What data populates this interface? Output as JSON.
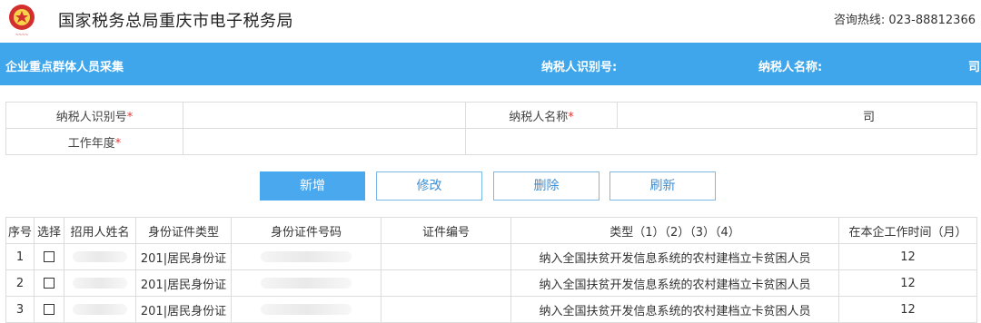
{
  "header": {
    "site_title": "国家税务总局重庆市电子税务局",
    "hotline": "咨询热线: 023-88812366",
    "emblem_icon": "tax-emblem-icon"
  },
  "bar": {
    "section_title": "企业重点群体人员采集",
    "taxpayer_id_label": "纳税人识别号:",
    "taxpayer_name_label": "纳税人名称:",
    "taxpayer_name_tail": "司"
  },
  "form": {
    "taxpayer_id_label": "纳税人识别号",
    "taxpayer_name_label": "纳税人名称",
    "taxpayer_name_tail": "司",
    "work_year_label": "工作年度",
    "required_mark": "*"
  },
  "toolbar": {
    "add_label": "新增",
    "edit_label": "修改",
    "delete_label": "删除",
    "refresh_label": "刷新"
  },
  "table": {
    "headers": [
      "序号",
      "选择",
      "招用人姓名",
      "身份证件类型",
      "身份证件号码",
      "证件编号",
      "类型（1）（2）（3）（4）",
      "在本企工作时间（月）"
    ],
    "rows": [
      {
        "no": "1",
        "id_type": "201|居民身份证",
        "type": "纳入全国扶贫开发信息系统的农村建档立卡贫困人员",
        "months": "12"
      },
      {
        "no": "2",
        "id_type": "201|居民身份证",
        "type": "纳入全国扶贫开发信息系统的农村建档立卡贫困人员",
        "months": "12"
      },
      {
        "no": "3",
        "id_type": "201|居民身份证",
        "type": "纳入全国扶贫开发信息系统的农村建档立卡贫困人员",
        "months": "12"
      }
    ]
  },
  "colors": {
    "bar_bg": "#3fa6ec",
    "primary_button": "#4aa8ee",
    "emblem_red": "#d32f2f",
    "required_red": "#e53935"
  }
}
